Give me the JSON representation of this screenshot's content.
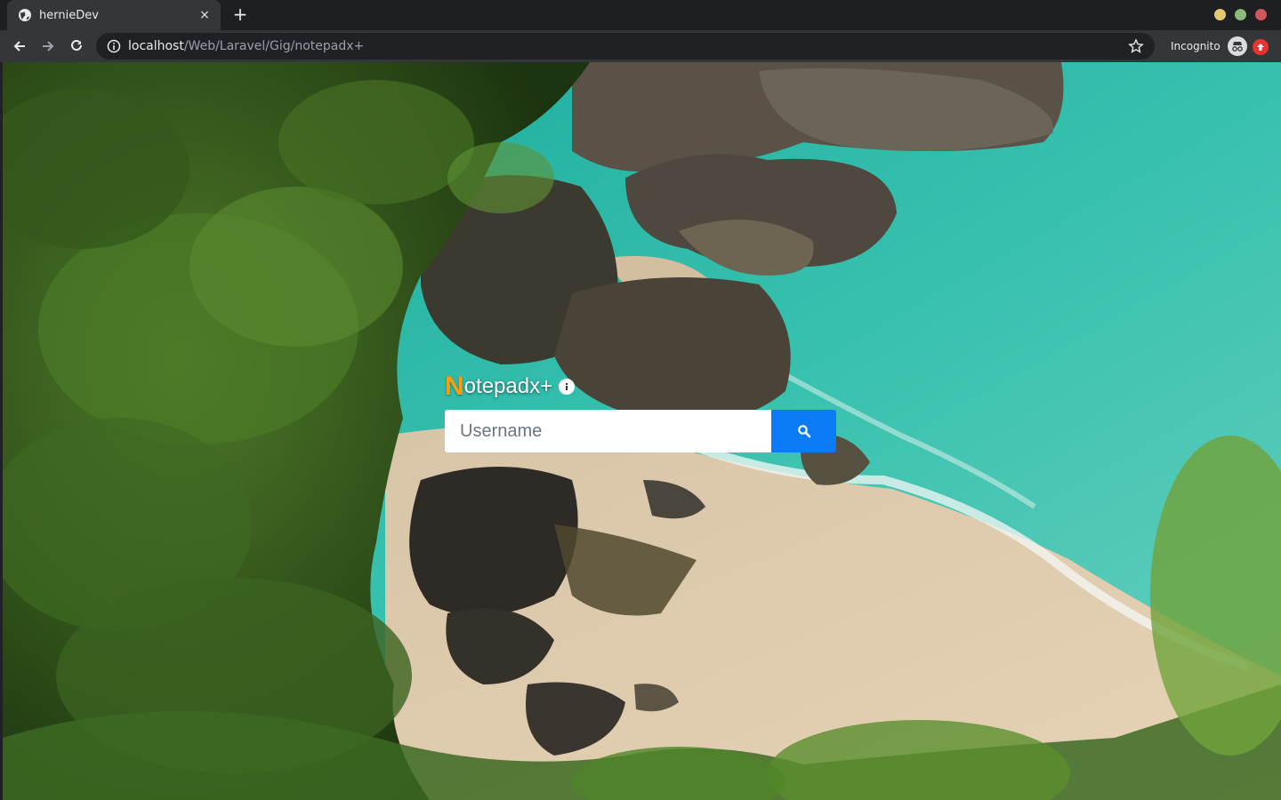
{
  "browser": {
    "tab_title": "hernieDev",
    "tab_close_glyph": "×",
    "new_tab_glyph": "+",
    "url_host": "localhost",
    "url_path": "/Web/Laravel/Gig/notepadx+",
    "incognito_label": "Incognito",
    "window_buttons": [
      {
        "name": "minimize",
        "color": "#e6c86e"
      },
      {
        "name": "maximize",
        "color": "#8fb97a"
      },
      {
        "name": "close",
        "color": "#d2555b"
      }
    ],
    "icons": [
      "globe-icon",
      "back-icon",
      "forward-icon",
      "reload-icon",
      "site-info-icon",
      "bookmark-star-icon",
      "incognito-icon",
      "extension-icon"
    ]
  },
  "app": {
    "brand_first_letter": "N",
    "brand_rest": "otepadx+",
    "brand_accent_color": "#f5a010",
    "search": {
      "placeholder": "Username",
      "value": "",
      "button_icon": "search-icon",
      "button_color": "#0b7cf5"
    }
  },
  "background": {
    "description_icon": "beach-landscape-image"
  }
}
